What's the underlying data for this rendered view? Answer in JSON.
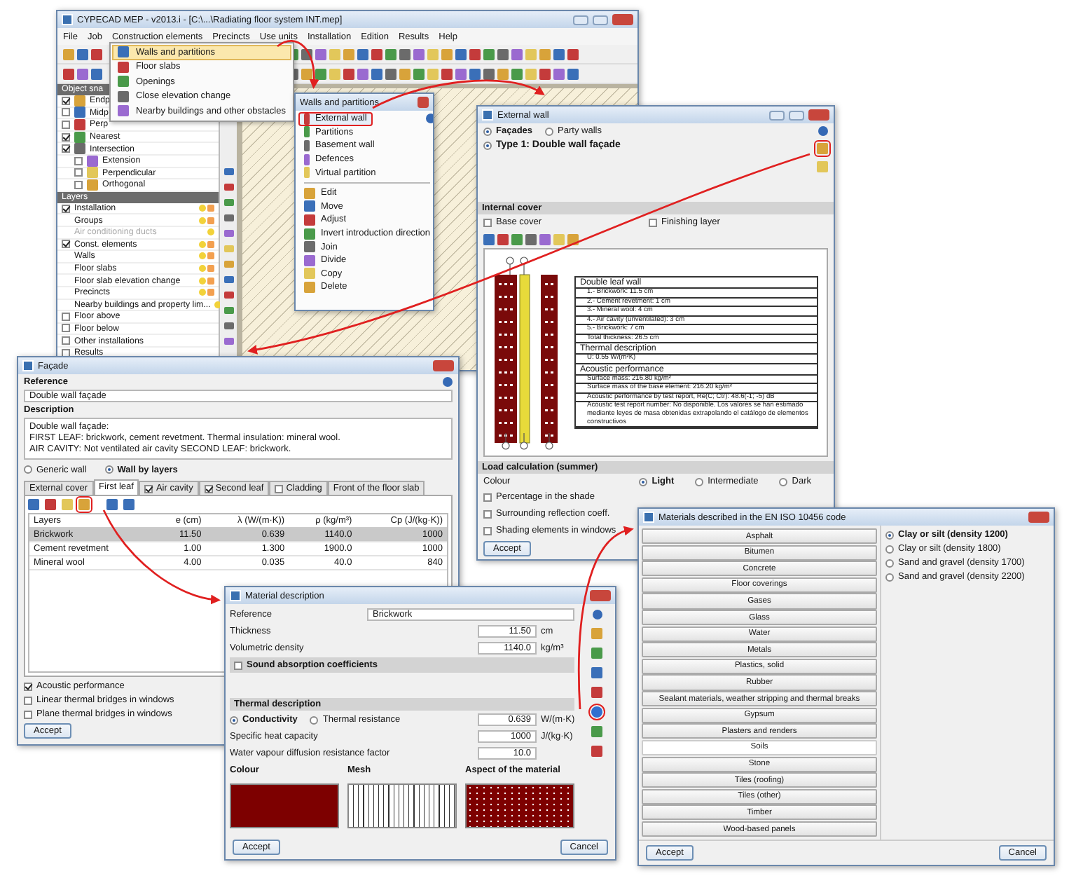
{
  "main_window": {
    "title": "CYPECAD MEP - v2013.i - [C:\\...\\Radiating floor system INT.mep]",
    "menu": [
      "File",
      "Job",
      "Construction elements",
      "Precincts",
      "Use units",
      "Installation",
      "Edition",
      "Results",
      "Help"
    ],
    "dropdown": [
      {
        "label": "Walls and partitions",
        "selected": true
      },
      {
        "label": "Floor slabs",
        "selected": false
      },
      {
        "label": "Openings",
        "selected": false
      },
      {
        "label": "Close elevation change",
        "selected": false
      },
      {
        "label": "Nearby buildings and other obstacles",
        "selected": false
      }
    ],
    "snap_panel": {
      "title": "Object sna",
      "items": [
        {
          "label": "Endp",
          "checked": true
        },
        {
          "label": "Midp",
          "checked": false
        },
        {
          "label": "Perp",
          "checked": false
        },
        {
          "label": "Nearest",
          "checked": true
        },
        {
          "label": "Intersection",
          "checked": true
        },
        {
          "label": "Extension",
          "checked": false
        },
        {
          "label": "Perpendicular",
          "checked": false
        },
        {
          "label": "Orthogonal",
          "checked": false
        }
      ]
    },
    "layers_panel": {
      "title": "Layers",
      "items": [
        {
          "label": "Installation",
          "checked": true,
          "children": [
            {
              "label": "Groups",
              "disabled": false
            },
            {
              "label": "Air conditioning ducts",
              "disabled": true
            }
          ]
        },
        {
          "label": "Const. elements",
          "checked": true,
          "children": [
            {
              "label": "Walls",
              "disabled": false
            },
            {
              "label": "Floor slabs",
              "disabled": false
            },
            {
              "label": "Floor slab elevation change",
              "disabled": false
            },
            {
              "label": "Precincts",
              "disabled": false
            },
            {
              "label": "Nearby buildings and property lim...",
              "disabled": false
            }
          ]
        },
        {
          "label": "Floor above",
          "checked": false
        },
        {
          "label": "Floor below",
          "checked": false
        },
        {
          "label": "Other installations",
          "checked": false
        },
        {
          "label": "Results",
          "checked": false
        }
      ]
    }
  },
  "walls_panel": {
    "title": "Walls and partitions",
    "wall_types": [
      {
        "label": "External wall",
        "selected": true
      },
      {
        "label": "Partitions",
        "selected": false
      },
      {
        "label": "Basement wall",
        "selected": false
      },
      {
        "label": "Defences",
        "selected": false
      },
      {
        "label": "Virtual partition",
        "selected": false
      }
    ],
    "tools": [
      "Edit",
      "Move",
      "Adjust",
      "Invert introduction direction",
      "Join",
      "Divide",
      "Copy",
      "Delete"
    ]
  },
  "external_wall_window": {
    "title": "External wall",
    "wall_groups": [
      {
        "label": "Façades",
        "selected": true
      },
      {
        "label": "Party walls",
        "selected": false
      }
    ],
    "types": [
      {
        "label": "Type 1: Double wall façade",
        "selected": true
      }
    ],
    "internal_cover": {
      "title": "Internal cover",
      "options": [
        {
          "label": "Base cover",
          "checked": false
        },
        {
          "label": "Finishing layer",
          "checked": false
        }
      ]
    },
    "preview": {
      "sections": [
        {
          "title": "Double leaf wall",
          "lines": [
            "1.- Brickwork: 11.5 cm",
            "2.- Cement revetment: 1 cm",
            "3.- Mineral wool: 4 cm",
            "4.- Air cavity (unventilated): 3 cm",
            "5.- Brickwork: 7 cm",
            "Total thickness: 26.5 cm"
          ]
        },
        {
          "title": "Thermal description",
          "lines": [
            "U: 0.55 W/(m²K)"
          ]
        },
        {
          "title": "Acoustic performance",
          "lines": [
            "Surface mass: 216.80 kg/m²",
            "Surface mass of the base element: 216.20 kg/m²",
            "Acoustic performance by test report, Re(C; Ctr): 48.6(-1; -5) dB",
            "Acoustic test report number: No disponible. Los valores se han estimado mediante leyes de masa obtenidas extrapolando el catálogo de elementos constructivos"
          ]
        }
      ]
    },
    "load_calculation": {
      "title": "Load calculation (summer)",
      "colour_label": "Colour",
      "colours": [
        {
          "label": "Light",
          "selected": true
        },
        {
          "label": "Intermediate",
          "selected": false
        },
        {
          "label": "Dark",
          "selected": false
        }
      ],
      "options": [
        {
          "label": "Percentage in the shade",
          "checked": false
        },
        {
          "label": "Surrounding reflection coeff.",
          "checked": false
        },
        {
          "label": "Shading elements in windows",
          "checked": false
        }
      ]
    },
    "accept": "Accept"
  },
  "facade_window": {
    "title": "Façade",
    "reference_label": "Reference",
    "reference": "Double wall façade",
    "description_label": "Description",
    "description": [
      "Double wall façade:",
      "FIRST LEAF: brickwork, cement revetment. Thermal insulation: mineral wool.",
      "AIR CAVITY: Not ventilated air cavity SECOND LEAF: brickwork."
    ],
    "modes": [
      {
        "label": "Generic wall",
        "selected": false
      },
      {
        "label": "Wall by layers",
        "selected": true
      }
    ],
    "tabs": [
      {
        "label": "External cover",
        "selected": false,
        "kind": "plain"
      },
      {
        "label": "First leaf",
        "selected": true,
        "kind": "plain"
      },
      {
        "label": "Air cavity",
        "selected": false,
        "kind": "check",
        "checked": true
      },
      {
        "label": "Second leaf",
        "selected": false,
        "kind": "check",
        "checked": true
      },
      {
        "label": "Cladding",
        "selected": false,
        "kind": "check",
        "checked": false
      },
      {
        "label": "Front of the floor slab",
        "selected": false,
        "kind": "plain"
      }
    ],
    "table": {
      "columns": [
        "Layers",
        "e (cm)",
        "λ (W/(m·K))",
        "ρ (kg/m³)",
        "Cp (J/(kg·K))"
      ],
      "rows": [
        {
          "cells": [
            "Brickwork",
            "11.50",
            "0.639",
            "1140.0",
            "1000"
          ],
          "selected": true
        },
        {
          "cells": [
            "Cement revetment",
            "1.00",
            "1.300",
            "1900.0",
            "1000"
          ],
          "selected": false
        },
        {
          "cells": [
            "Mineral wool",
            "4.00",
            "0.035",
            "40.0",
            "840"
          ],
          "selected": false
        }
      ]
    },
    "options": [
      {
        "label": "Acoustic performance",
        "checked": true
      },
      {
        "label": "Linear thermal bridges in windows",
        "checked": false
      },
      {
        "label": "Plane thermal bridges in windows",
        "checked": false
      }
    ],
    "accept": "Accept"
  },
  "material_window": {
    "title": "Material description",
    "reference_label": "Reference",
    "reference": "Brickwork",
    "properties": [
      {
        "label": "Thickness",
        "value": "11.50",
        "unit": "cm"
      },
      {
        "label": "Volumetric density",
        "value": "1140.0",
        "unit": "kg/m³"
      }
    ],
    "sound": {
      "label": "Sound absorption coefficients",
      "checked": false
    },
    "thermal": {
      "title": "Thermal description",
      "modes": [
        {
          "label": "Conductivity",
          "selected": true
        },
        {
          "label": "Thermal resistance",
          "selected": false
        }
      ],
      "value": "0.639",
      "unit": "W/(m·K)",
      "properties": [
        {
          "label": "Specific heat capacity",
          "value": "1000",
          "unit": "J/(kg·K)"
        },
        {
          "label": "Water vapour diffusion resistance factor",
          "value": "10.0"
        }
      ]
    },
    "appearance": {
      "colour_label": "Colour",
      "mesh_label": "Mesh",
      "aspect_label": "Aspect of the material",
      "color": "#7d0000"
    },
    "accept": "Accept",
    "cancel": "Cancel"
  },
  "materials_window": {
    "title": "Materials described in the EN ISO 10456 code",
    "categories": [
      {
        "label": "Asphalt",
        "selected": false
      },
      {
        "label": "Bitumen",
        "selected": false
      },
      {
        "label": "Concrete",
        "selected": false
      },
      {
        "label": "Floor coverings",
        "selected": false
      },
      {
        "label": "Gases",
        "selected": false
      },
      {
        "label": "Glass",
        "selected": false
      },
      {
        "label": "Water",
        "selected": false
      },
      {
        "label": "Metals",
        "selected": false
      },
      {
        "label": "Plastics, solid",
        "selected": false
      },
      {
        "label": "Rubber",
        "selected": false
      },
      {
        "label": "Sealant materials, weather stripping and thermal breaks",
        "selected": false
      },
      {
        "label": "Gypsum",
        "selected": false
      },
      {
        "label": "Plasters and renders",
        "selected": false
      },
      {
        "label": "Soils",
        "selected": true
      },
      {
        "label": "Stone",
        "selected": false
      },
      {
        "label": "Tiles (roofing)",
        "selected": false
      },
      {
        "label": "Tiles (other)",
        "selected": false
      },
      {
        "label": "Timber",
        "selected": false
      },
      {
        "label": "Wood-based panels",
        "selected": false
      }
    ],
    "options": [
      {
        "label": "Clay or silt (density 1200)",
        "selected": true
      },
      {
        "label": "Clay or silt (density 1800)",
        "selected": false
      },
      {
        "label": "Sand and gravel (density 1700)",
        "selected": false
      },
      {
        "label": "Sand and gravel (density 2200)",
        "selected": false
      }
    ],
    "accept": "Accept",
    "cancel": "Cancel"
  }
}
